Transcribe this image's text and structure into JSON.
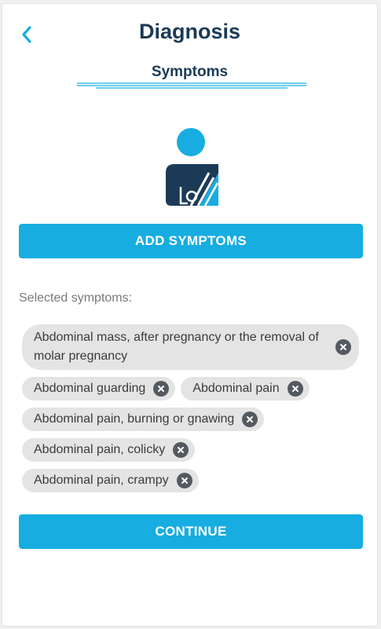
{
  "header": {
    "back_icon": "chevron-left-icon",
    "title": "Diagnosis",
    "subtitle": "Symptoms"
  },
  "illustration": {
    "icon": "person-with-medical-chart-icon",
    "colors": {
      "head": "#17ade0",
      "body": "#1b3a57"
    }
  },
  "actions": {
    "add_label": "ADD SYMPTOMS",
    "continue_label": "CONTINUE"
  },
  "selected": {
    "label": "Selected symptoms:",
    "items": [
      "Abdominal mass, after pregnancy or the removal of molar pregnancy",
      "Abdominal guarding",
      "Abdominal pain",
      "Abdominal pain, burning or gnawing",
      "Abdominal pain, colicky",
      "Abdominal pain, crampy"
    ]
  },
  "colors": {
    "accent": "#17ade0",
    "title": "#1b3a57",
    "chip_bg": "#e4e4e4",
    "remove_icon_bg": "#555a60"
  }
}
